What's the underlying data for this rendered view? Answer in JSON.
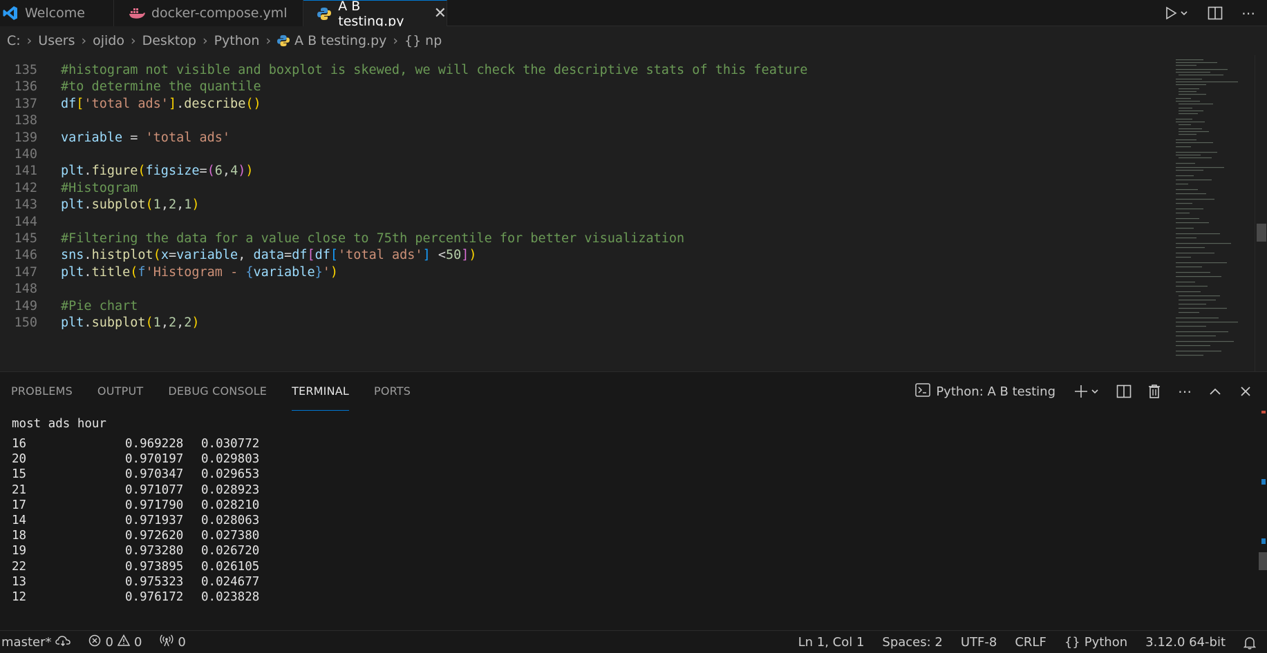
{
  "tabs": [
    {
      "label": "Welcome",
      "icon": "vscode-icon",
      "active": false
    },
    {
      "label": "docker-compose.yml",
      "icon": "docker-icon",
      "active": false
    },
    {
      "label": "A B testing.py",
      "icon": "python-icon",
      "active": true
    }
  ],
  "breadcrumb": [
    "C:",
    "Users",
    "ojido",
    "Desktop",
    "Python",
    "A B testing.py",
    "np"
  ],
  "breadcrumb_symbol": "{}",
  "editor": {
    "lines": [
      {
        "n": "135",
        "text": "#histogram not visible and boxplot is skewed, we will check the descriptive stats of this feature"
      },
      {
        "n": "136",
        "text": "#to determine the quantile"
      },
      {
        "n": "137",
        "text": "df['total ads'].describe()"
      },
      {
        "n": "138",
        "text": ""
      },
      {
        "n": "139",
        "text": "variable = 'total ads'"
      },
      {
        "n": "140",
        "text": ""
      },
      {
        "n": "141",
        "text": "plt.figure(figsize=(6,4))"
      },
      {
        "n": "142",
        "text": "#Histogram"
      },
      {
        "n": "143",
        "text": "plt.subplot(1,2,1)"
      },
      {
        "n": "144",
        "text": ""
      },
      {
        "n": "145",
        "text": "#Filtering the data for a value close to 75th percentile for better visualization"
      },
      {
        "n": "146",
        "text": "sns.histplot(x=variable, data=df[df['total ads'] <50])"
      },
      {
        "n": "147",
        "text": "plt.title(f'Histogram - {variable}')"
      },
      {
        "n": "148",
        "text": ""
      },
      {
        "n": "149",
        "text": "#Pie chart"
      },
      {
        "n": "150",
        "text": "plt.subplot(1,2,2)"
      }
    ]
  },
  "panel": {
    "tabs": [
      "PROBLEMS",
      "OUTPUT",
      "DEBUG CONSOLE",
      "TERMINAL",
      "PORTS"
    ],
    "active_tab": "TERMINAL",
    "terminal_name": "Python: A B testing"
  },
  "terminal": {
    "header": "most ads hour",
    "rows": [
      [
        "16",
        "0.969228",
        "0.030772"
      ],
      [
        "20",
        "0.970197",
        "0.029803"
      ],
      [
        "15",
        "0.970347",
        "0.029653"
      ],
      [
        "21",
        "0.971077",
        "0.028923"
      ],
      [
        "17",
        "0.971790",
        "0.028210"
      ],
      [
        "14",
        "0.971937",
        "0.028063"
      ],
      [
        "18",
        "0.972620",
        "0.027380"
      ],
      [
        "19",
        "0.973280",
        "0.026720"
      ],
      [
        "22",
        "0.973895",
        "0.026105"
      ],
      [
        "13",
        "0.975323",
        "0.024677"
      ],
      [
        "12",
        "0.976172",
        "0.023828"
      ]
    ]
  },
  "statusbar": {
    "branch": "master*",
    "errors": "0",
    "warnings": "0",
    "ports": "0",
    "position": "Ln 1, Col 1",
    "spaces": "Spaces: 2",
    "encoding": "UTF-8",
    "eol": "CRLF",
    "language": "Python",
    "interpreter": "3.12.0 64-bit"
  },
  "colors": {
    "accent": "#0078d4",
    "comment": "#6a9955",
    "string": "#ce9178",
    "variable": "#9cdcfe",
    "function": "#dcdcaa",
    "number": "#b5cea8"
  }
}
